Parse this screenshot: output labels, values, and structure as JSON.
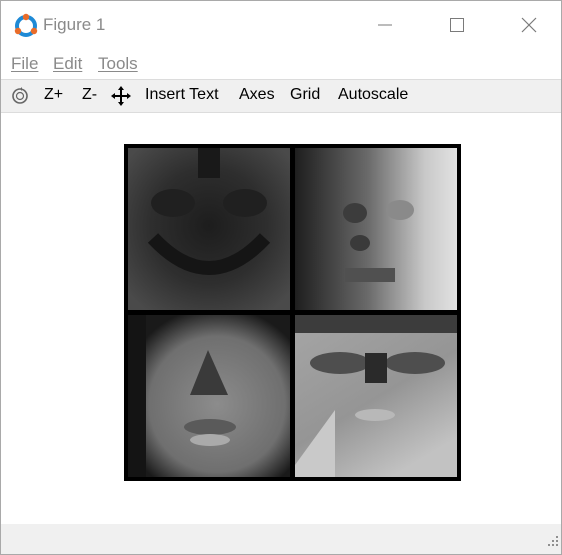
{
  "window": {
    "title": "Figure 1"
  },
  "menu": {
    "file": "File",
    "edit": "Edit",
    "tools": "Tools"
  },
  "toolbar": {
    "zoom_in": "Z+",
    "zoom_out": "Z-",
    "insert_text": "Insert Text",
    "axes": "Axes",
    "grid": "Grid",
    "autoscale": "Autoscale",
    "icons": [
      "rotate-icon",
      "pan-icon"
    ]
  },
  "figure": {
    "description": "2x2 grid of grayscale eigenface images",
    "panels": 4,
    "colormap": "gray"
  }
}
